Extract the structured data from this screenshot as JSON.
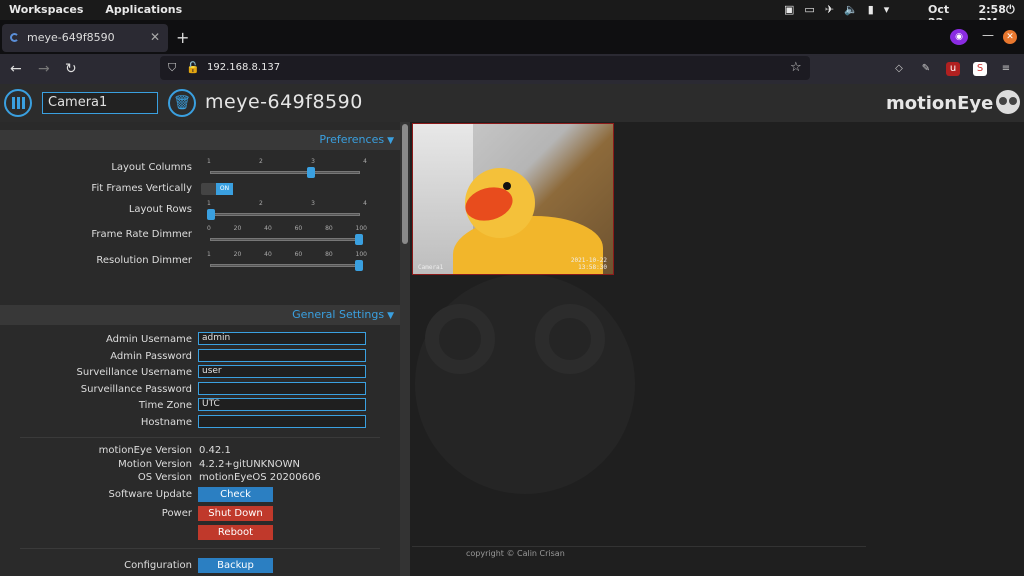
{
  "system": {
    "workspaces": "Workspaces",
    "applications": "Applications",
    "date": "Oct 22",
    "time": "2:58 PM"
  },
  "browser": {
    "tab_title": "meye-649f8590",
    "url": "192.168.8.137"
  },
  "header": {
    "camera_select": "Camera1",
    "device_name": "meye-649f8590",
    "brand": "motionEye"
  },
  "preferences": {
    "title": "Preferences",
    "layout_columns": {
      "label": "Layout Columns",
      "ticks": [
        "1",
        "2",
        "3",
        "4"
      ],
      "value": 3
    },
    "fit_frames": {
      "label": "Fit Frames Vertically",
      "state": "ON"
    },
    "layout_rows": {
      "label": "Layout Rows",
      "ticks": [
        "1",
        "2",
        "3",
        "4"
      ],
      "value": 1
    },
    "frame_rate_dimmer": {
      "label": "Frame Rate Dimmer",
      "ticks": [
        "0",
        "20",
        "40",
        "60",
        "80",
        "100"
      ],
      "value": 100
    },
    "resolution_dimmer": {
      "label": "Resolution Dimmer",
      "ticks": [
        "1",
        "20",
        "40",
        "60",
        "80",
        "100"
      ],
      "value": 100
    }
  },
  "general": {
    "title": "General Settings",
    "admin_username": {
      "label": "Admin Username",
      "value": "admin"
    },
    "admin_password": {
      "label": "Admin Password",
      "value": ""
    },
    "surveillance_username": {
      "label": "Surveillance Username",
      "value": "user"
    },
    "surveillance_password": {
      "label": "Surveillance Password",
      "value": ""
    },
    "time_zone": {
      "label": "Time Zone",
      "value": "UTC"
    },
    "hostname": {
      "label": "Hostname",
      "value": ""
    },
    "motioneye_version": {
      "label": "motionEye Version",
      "value": "0.42.1"
    },
    "motion_version": {
      "label": "Motion Version",
      "value": "4.2.2+gitUNKNOWN"
    },
    "os_version": {
      "label": "OS Version",
      "value": "motionEyeOS 20200606"
    },
    "software_update": {
      "label": "Software Update",
      "button": "Check"
    },
    "power": {
      "label": "Power",
      "shutdown": "Shut Down",
      "reboot": "Reboot"
    },
    "configuration": {
      "label": "Configuration",
      "button": "Backup"
    }
  },
  "camera": {
    "name": "Camera1",
    "timestamp_date": "2021-10-22",
    "timestamp_time": "13:58:30"
  },
  "footer": {
    "copyright": "copyright © Calin Crisan"
  }
}
